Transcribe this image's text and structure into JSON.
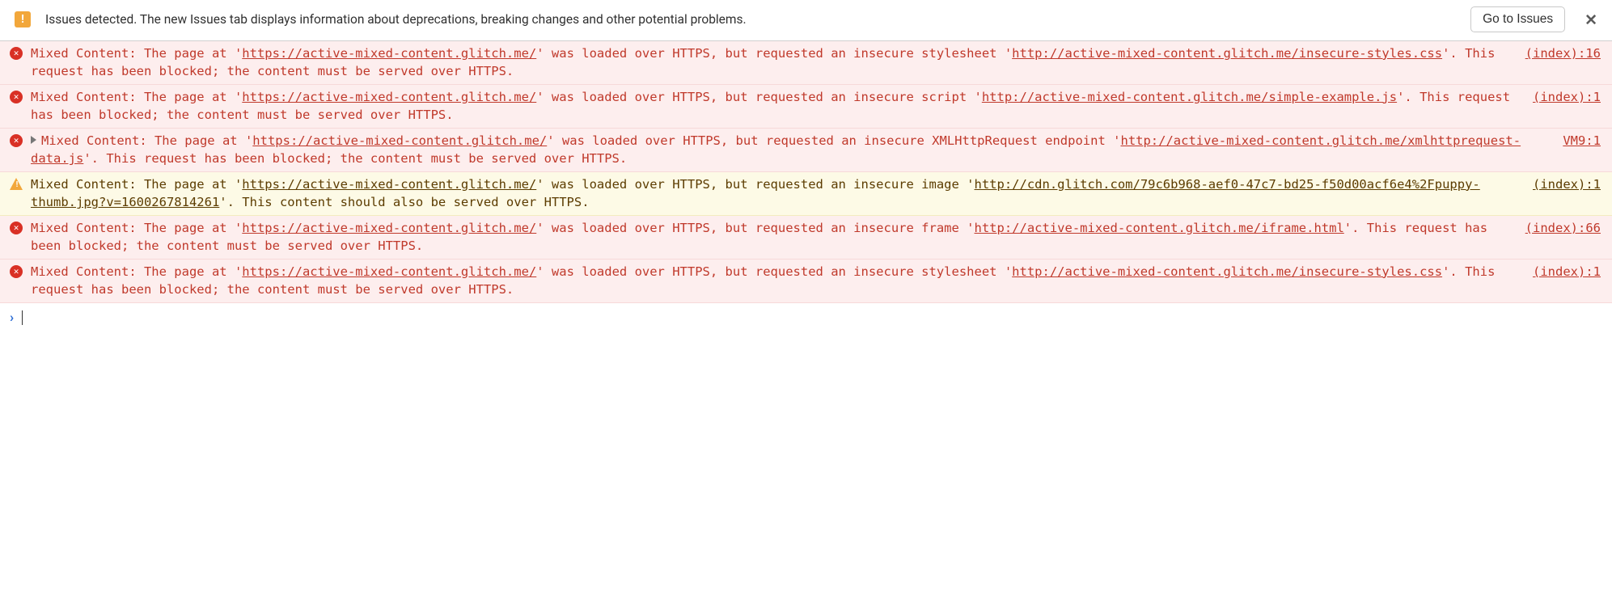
{
  "issues_bar": {
    "text": "Issues detected. The new Issues tab displays information about deprecations, breaking changes and other potential problems.",
    "button": "Go to Issues",
    "close": "✕"
  },
  "page_url": "https://active-mixed-content.glitch.me/",
  "blocked_tail": "'. This request has been blocked; the content must be served over HTTPS.",
  "should_tail": "'. This content should also be served over HTTPS.",
  "entries": [
    {
      "level": "error",
      "expandable": false,
      "resource_kind": "stylesheet",
      "resource_url": "http://active-mixed-content.glitch.me/insecure-styles.css",
      "tail_key": "blocked_tail",
      "source": "(index):16"
    },
    {
      "level": "error",
      "expandable": false,
      "resource_kind": "script",
      "resource_url": "http://active-mixed-content.glitch.me/simple-example.js",
      "tail_key": "blocked_tail",
      "source": "(index):1"
    },
    {
      "level": "error",
      "expandable": true,
      "resource_kind": "XMLHttpRequest endpoint",
      "resource_url": "http://active-mixed-content.glitch.me/xmlhttprequest-data.js",
      "tail_key": "blocked_tail",
      "source": "VM9:1"
    },
    {
      "level": "warning",
      "expandable": false,
      "resource_kind": "image",
      "resource_url": "http://cdn.glitch.com/79c6b968-aef0-47c7-bd25-f50d00acf6e4%2Fpuppy-thumb.jpg?v=1600267814261",
      "tail_key": "should_tail",
      "source": "(index):1"
    },
    {
      "level": "error",
      "expandable": false,
      "resource_kind": "frame",
      "resource_url": "http://active-mixed-content.glitch.me/iframe.html",
      "tail_key": "blocked_tail",
      "source": "(index):66"
    },
    {
      "level": "error",
      "expandable": false,
      "resource_kind": "stylesheet",
      "resource_url": "http://active-mixed-content.glitch.me/insecure-styles.css",
      "tail_key": "blocked_tail",
      "source": "(index):1"
    }
  ],
  "msg_prefix": "Mixed Content: The page at '",
  "msg_mid": "' was loaded over HTTPS, but requested an insecure "
}
